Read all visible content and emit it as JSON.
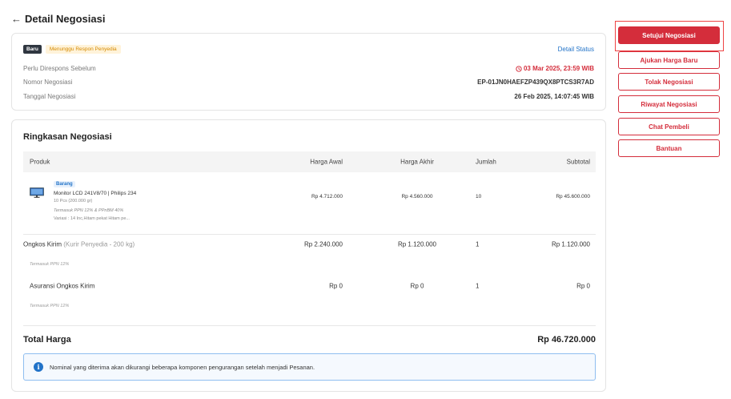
{
  "header": {
    "back_icon": "←",
    "title": "Detail Negosiasi"
  },
  "status_card": {
    "badge_new": "Baru",
    "badge_status": "Menunggu Respon Penyedia",
    "detail_link": "Detail Status",
    "rows": [
      {
        "label": "Perlu Direspons Sebelum",
        "value": "03 Mar 2025, 23:59 WIB"
      },
      {
        "label": "Nomor Negosiasi",
        "value": "EP-01JN0HAEFZP439QX8PTCS3R7AD"
      },
      {
        "label": "Tanggal Negosiasi",
        "value": "26 Feb 2025, 14:07:45 WIB"
      }
    ],
    "deadline_color": "#d42d3b"
  },
  "summary": {
    "title": "Ringkasan Negosiasi",
    "columns": {
      "product": "Produk",
      "initial": "Harga Awal",
      "final": "Harga Akhir",
      "qty": "Jumlah",
      "subtotal": "Subtotal"
    },
    "item": {
      "tag": "Barang",
      "name": "Monitor LCD 241V8/70 | Philips 234",
      "qty_detail": "10 Pcs (200.000 gr)",
      "tax_note": "Termasuk PPN 12% & PPnBM 40%",
      "variant": "Variasi   : 14 Inc,Hitam pekat Hitam pe...",
      "initial": "Rp 4.712.000",
      "final": "Rp 4.560.000",
      "qty": "10",
      "subtotal": "Rp 45.600.000"
    },
    "shipping": {
      "label": "Ongkos Kirim",
      "detail": "(Kurir Penyedia - 200 kg)",
      "note": "Termasuk PPN 12%",
      "initial": "Rp 2.240.000",
      "final": "Rp 1.120.000",
      "qty": "1",
      "subtotal": "Rp 1.120.000"
    },
    "insurance": {
      "label": "Asuransi Ongkos Kirim",
      "note": "Termasuk PPN 12%",
      "initial": "Rp 0",
      "final": "Rp 0",
      "qty": "1",
      "subtotal": "Rp 0"
    },
    "total_label": "Total Harga",
    "total_value": "Rp 46.720.000",
    "info_text": "Nominal yang diterima akan dikurangi beberapa komponen pengurangan setelah menjadi Pesanan."
  },
  "actions": {
    "approve": "Setujui Negosiasi",
    "propose": "Ajukan Harga Baru",
    "reject": "Tolak Negosiasi",
    "history": "Riwayat Negosiasi",
    "chat": "Chat Pembeli",
    "help": "Bantuan",
    "accent_color": "#d42d3b"
  }
}
